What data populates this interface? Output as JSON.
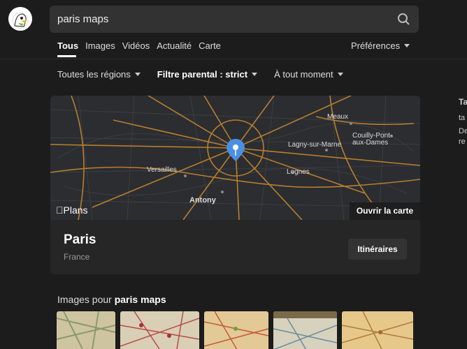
{
  "search": {
    "query": "paris maps"
  },
  "tabs": [
    {
      "label": "Tous"
    },
    {
      "label": "Images"
    },
    {
      "label": "Vidéos"
    },
    {
      "label": "Actualité"
    },
    {
      "label": "Carte"
    }
  ],
  "preferences_label": "Préférences",
  "filters": {
    "region": "Toutes les régions",
    "safe_search": "Filtre parental : strict",
    "time": "À tout moment"
  },
  "map_card": {
    "cities": [
      "Meaux",
      "Couilly-Pont-aux-Dames",
      "Lagny-sur-Marne",
      "Versailles",
      "Lognes",
      "Antony"
    ],
    "provider": "Plans",
    "open_map": "Ouvrir la carte",
    "place_name": "Paris",
    "place_country": "France",
    "directions": "Itinéraires"
  },
  "images_section": {
    "prefix": "Images pour ",
    "query": "paris maps"
  },
  "right_panel": {
    "line1": "Ta",
    "line2": "ta",
    "line3": "De",
    "line4": "re"
  },
  "colors": {
    "accent": "#4a90e2",
    "road": "#c8882e",
    "background": "#1c1c1c"
  }
}
